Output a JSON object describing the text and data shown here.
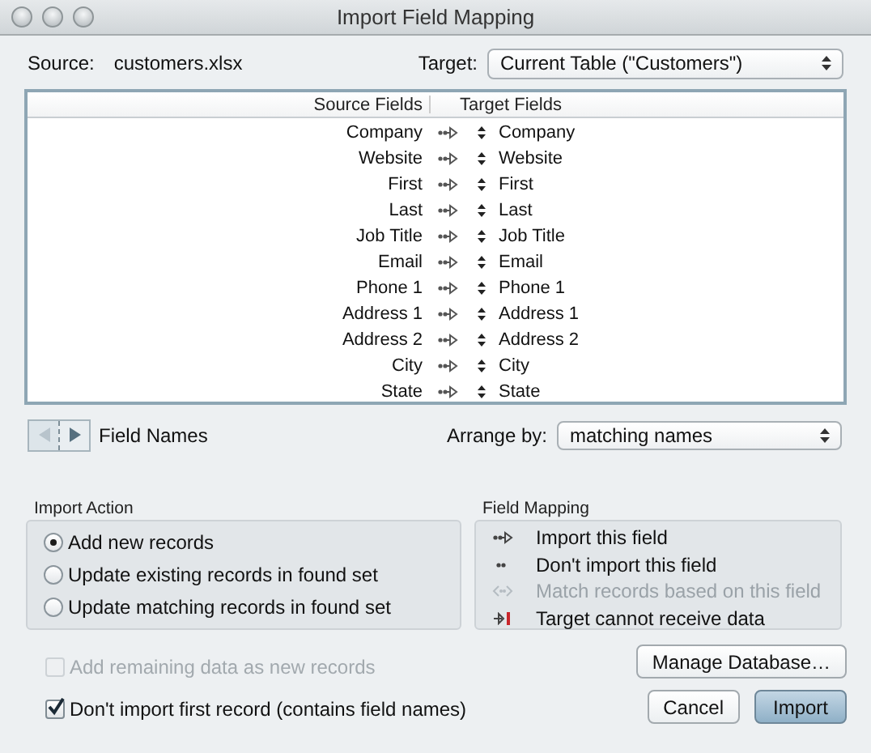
{
  "window": {
    "title": "Import Field Mapping"
  },
  "source": {
    "label": "Source:",
    "value": "customers.xlsx"
  },
  "target": {
    "label": "Target:",
    "value": "Current Table (\"Customers\")"
  },
  "table": {
    "columns": [
      "Source Fields",
      "Target Fields"
    ],
    "rows": [
      {
        "source": "Company",
        "kind": "import",
        "target": "Company"
      },
      {
        "source": "Website",
        "kind": "import",
        "target": "Website"
      },
      {
        "source": "First",
        "kind": "import",
        "target": "First"
      },
      {
        "source": "Last",
        "kind": "import",
        "target": "Last"
      },
      {
        "source": "Job Title",
        "kind": "import",
        "target": "Job Title"
      },
      {
        "source": "Email",
        "kind": "import",
        "target": "Email"
      },
      {
        "source": "Phone 1",
        "kind": "import",
        "target": "Phone 1"
      },
      {
        "source": "Address 1",
        "kind": "import",
        "target": "Address 1"
      },
      {
        "source": "Address 2",
        "kind": "import",
        "target": "Address 2"
      },
      {
        "source": "City",
        "kind": "import",
        "target": "City"
      },
      {
        "source": "State",
        "kind": "import",
        "target": "State"
      }
    ]
  },
  "record_nav": {
    "label": "Field Names"
  },
  "arrange": {
    "label": "Arrange by:",
    "value": "matching names"
  },
  "import_action": {
    "title": "Import Action",
    "options": [
      {
        "label": "Add new records",
        "selected": true
      },
      {
        "label": "Update existing records in found set",
        "selected": false
      },
      {
        "label": "Update matching records in found set",
        "selected": false
      }
    ]
  },
  "field_mapping": {
    "title": "Field Mapping",
    "items": [
      {
        "kind": "import",
        "label": "Import this field",
        "disabled": false
      },
      {
        "kind": "skip",
        "label": "Don't import this field",
        "disabled": false
      },
      {
        "kind": "match",
        "label": "Match records based on this field",
        "disabled": true
      },
      {
        "kind": "blocked",
        "label": "Target cannot receive data",
        "disabled": false
      }
    ]
  },
  "checkboxes": [
    {
      "label": "Add remaining data as new records",
      "checked": false,
      "disabled": true
    },
    {
      "label": "Don't import first record (contains field names)",
      "checked": true,
      "disabled": false
    }
  ],
  "buttons": [
    {
      "label": "Manage Database…",
      "kind": "normal"
    },
    {
      "label": "Cancel",
      "kind": "normal"
    },
    {
      "label": "Import",
      "kind": "default"
    }
  ]
}
